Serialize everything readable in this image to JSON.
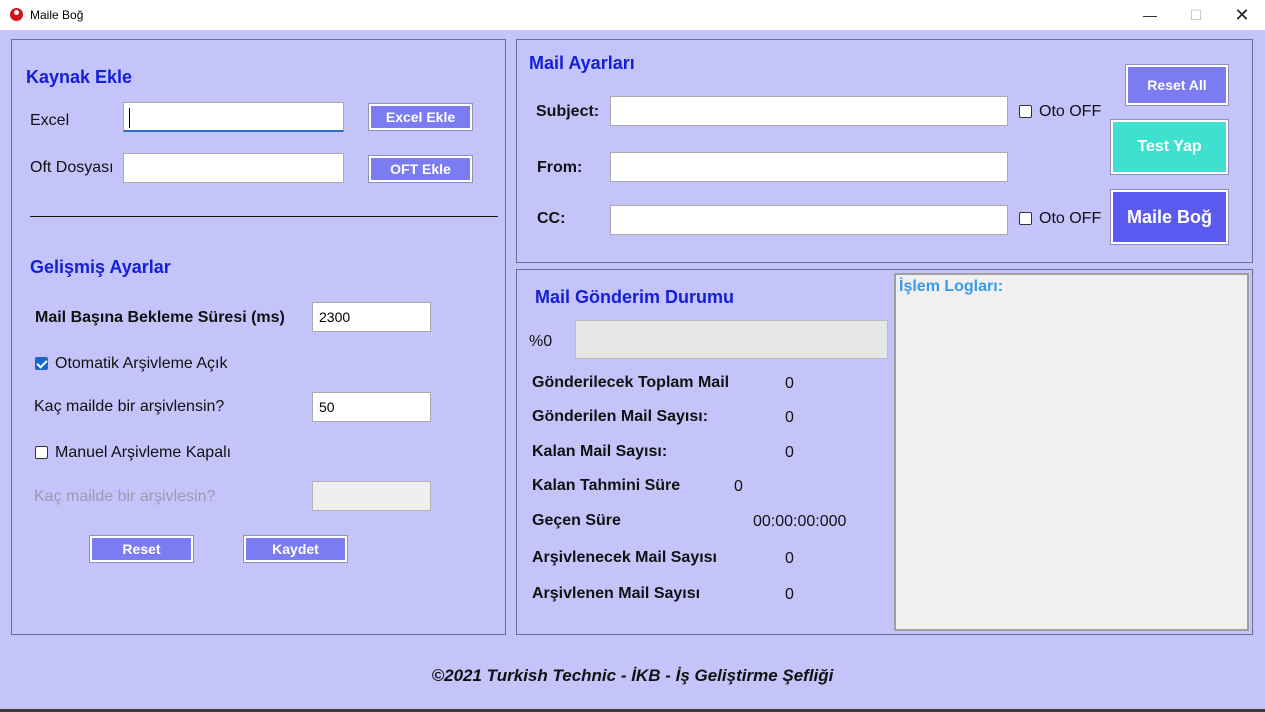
{
  "window": {
    "title": "Maile Boğ",
    "min": "—",
    "max": "☐",
    "close": "✕"
  },
  "left": {
    "source_heading": "Kaynak Ekle",
    "excel_label": "Excel",
    "excel_value": "",
    "excel_button": "Excel Ekle",
    "oft_label": "Oft Dosyası",
    "oft_value": "",
    "oft_button": "OFT Ekle",
    "advanced_heading": "Gelişmiş Ayarlar",
    "wait_label": "Mail Başına Bekleme Süresi (ms)",
    "wait_value": "2300",
    "auto_archive_label": "Otomatik Arşivleme Açık",
    "auto_archive_checked": true,
    "auto_archive_count_label": "Kaç mailde bir arşivlensin?",
    "auto_archive_count_value": "50",
    "manual_archive_label": "Manuel Arşivleme Kapalı",
    "manual_archive_checked": false,
    "manual_archive_count_label": "Kaç mailde bir arşivlesin?",
    "manual_archive_count_value": "",
    "reset_button": "Reset",
    "save_button": "Kaydet"
  },
  "mail_settings": {
    "heading": "Mail Ayarları",
    "subject_label": "Subject:",
    "subject_value": "",
    "subject_auto_label": "Oto OFF",
    "from_label": "From:",
    "from_value": "",
    "cc_label": "CC:",
    "cc_value": "",
    "cc_auto_label": "Oto OFF",
    "reset_all_button": "Reset All",
    "test_button": "Test Yap",
    "send_button": "Maile Boğ"
  },
  "status": {
    "heading": "Mail Gönderim Durumu",
    "progress_text": "%0",
    "progress_percent": 0,
    "total_label": "Gönderilecek Toplam Mail",
    "total_value": "0",
    "sent_label": "Gönderilen Mail Sayısı:",
    "sent_value": "0",
    "remaining_label": "Kalan Mail Sayısı:",
    "remaining_value": "0",
    "eta_label": "Kalan Tahmini Süre",
    "eta_value": "0",
    "elapsed_label": "Geçen Süre",
    "elapsed_value": "00:00:00:000",
    "to_archive_label": "Arşivlenecek Mail Sayısı",
    "to_archive_value": "0",
    "archived_label": "Arşivlenen Mail Sayısı",
    "archived_value": "0"
  },
  "logs": {
    "title": "İşlem Logları:"
  },
  "footer": "©2021 Turkish Technic - İKB - İş Geliştirme Şefliği"
}
